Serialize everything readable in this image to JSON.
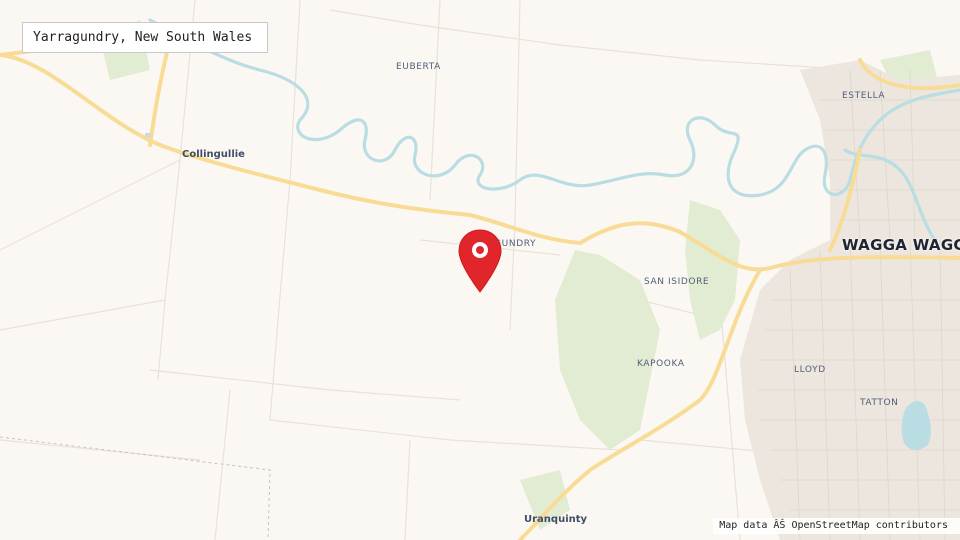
{
  "title": "Yarragundry, New South Wales",
  "attribution": "Map data ÂŠ OpenStreetMap contributors",
  "places": {
    "euberta": "EUBERTA",
    "estella": "ESTELLA",
    "collingullie": "Collingullie",
    "yarragundry": "YARRAGUNDRY",
    "san_isidore": "SAN ISIDORE",
    "wagga_wagga": "WAGGA WAGGA",
    "kapooka": "KAPOOKA",
    "lloyd": "LLOYD",
    "tatton": "TATTON",
    "uranquinty": "Uranquinty"
  },
  "marker": {
    "icon": "map-pin-icon",
    "color": "#e0262a"
  },
  "colors": {
    "land": "#fbf8f3",
    "road_major": "#fbdf9a",
    "road_minor": "#e8e2d8",
    "river": "#b9dde2",
    "forest": "#e2ecd3",
    "urban": "#ece6de"
  }
}
